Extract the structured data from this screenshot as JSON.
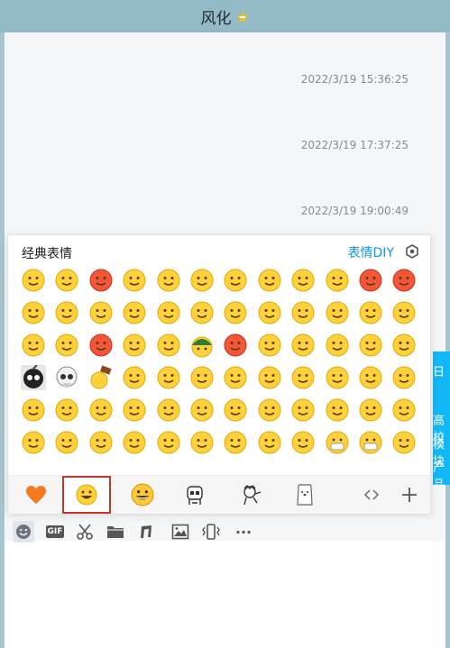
{
  "window": {
    "title": "风化",
    "title_badge_icon": "crown-star-icon"
  },
  "chat": {
    "timestamps": [
      "2022/3/19 15:36:25",
      "2022/3/19 17:37:25",
      "2022/3/19 19:00:49"
    ],
    "partial_message_chars": [
      "日",
      "高校",
      "模块",
      "产品"
    ]
  },
  "emoji_panel": {
    "title": "经典表情",
    "diy_label": "表情DIY",
    "settings_icon": "gear-icon",
    "rows": 6,
    "columns": 12,
    "emoji_names": [
      "smile",
      "pout",
      "heart-eyes",
      "dizzy",
      "cool",
      "sob",
      "grievance",
      "scared",
      "tongue",
      "tear",
      "angry-red",
      "embarrassed",
      "kiss",
      "grin-teeth",
      "mock",
      "sad",
      "sunglasses-cool",
      "sweat",
      "furious",
      "cry-loud",
      "hmm",
      "smirk",
      "surprised",
      "doubt",
      "wink",
      "shy",
      "angry-mark",
      "scold",
      "laugh",
      "soldier",
      "bandana",
      "flushed",
      "puzzled",
      "dizzy-eyes",
      "speechless",
      "yawn",
      "bomb",
      "skull",
      "hammer",
      "bye",
      "thumbs",
      "facepalm",
      "think",
      "shock",
      "weep",
      "sneaky",
      "salute",
      "eek",
      "clap",
      "pray",
      "sigh",
      "smug",
      "hmph",
      "oops",
      "awkward",
      "stunned",
      "grumpy",
      "cry-laugh",
      "poke",
      "applause",
      "hug",
      "cover-mouth",
      "blush",
      "laugh-tear",
      "drool",
      "pinch",
      "peek",
      "bashful",
      "tired",
      "doctor",
      "mask",
      "cute"
    ]
  },
  "tabs": {
    "items": [
      "favorites-heart-icon",
      "classic-emoji-tab-icon",
      "yellow-face-tab-icon",
      "sticker-pack-1-icon",
      "sticker-pack-2-icon",
      "bear-sticker-icon"
    ],
    "selected_index": 1,
    "scroll_icon": "scroll-arrows-icon",
    "add_icon": "plus-icon"
  },
  "toolbar": {
    "items": [
      "emoji-icon",
      "gif-icon",
      "scissors-icon",
      "folder-icon",
      "music-icon",
      "image-icon",
      "vibrate-icon",
      "more-icon"
    ],
    "gif_label": "GIF",
    "more_label": "···"
  },
  "colors": {
    "title_bar": "#94b9c7",
    "accent_blue": "#1296db",
    "selected_outline": "#c0392b",
    "heart": "#f37b1d",
    "emoji_yellow": "#ffd23c"
  }
}
